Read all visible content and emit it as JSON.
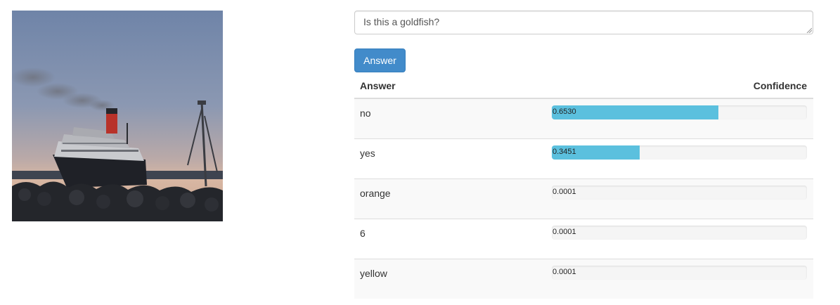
{
  "image": {
    "subject": "ocean-liner-at-sunset"
  },
  "question": {
    "value": "Is this a goldfish?"
  },
  "submit": {
    "label": "Answer"
  },
  "results": {
    "headers": {
      "answer": "Answer",
      "confidence": "Confidence"
    },
    "rows": [
      {
        "answer": "no",
        "confidence_text": "0.6530",
        "confidence": 0.653
      },
      {
        "answer": "yes",
        "confidence_text": "0.3451",
        "confidence": 0.3451
      },
      {
        "answer": "orange",
        "confidence_text": "0.0001",
        "confidence": 0.0001
      },
      {
        "answer": "6",
        "confidence_text": "0.0001",
        "confidence": 0.0001
      },
      {
        "answer": "yellow",
        "confidence_text": "0.0001",
        "confidence": 0.0001
      }
    ]
  },
  "colors": {
    "primary": "#428bca",
    "bar": "#5bc0de",
    "track": "#f5f5f5"
  }
}
